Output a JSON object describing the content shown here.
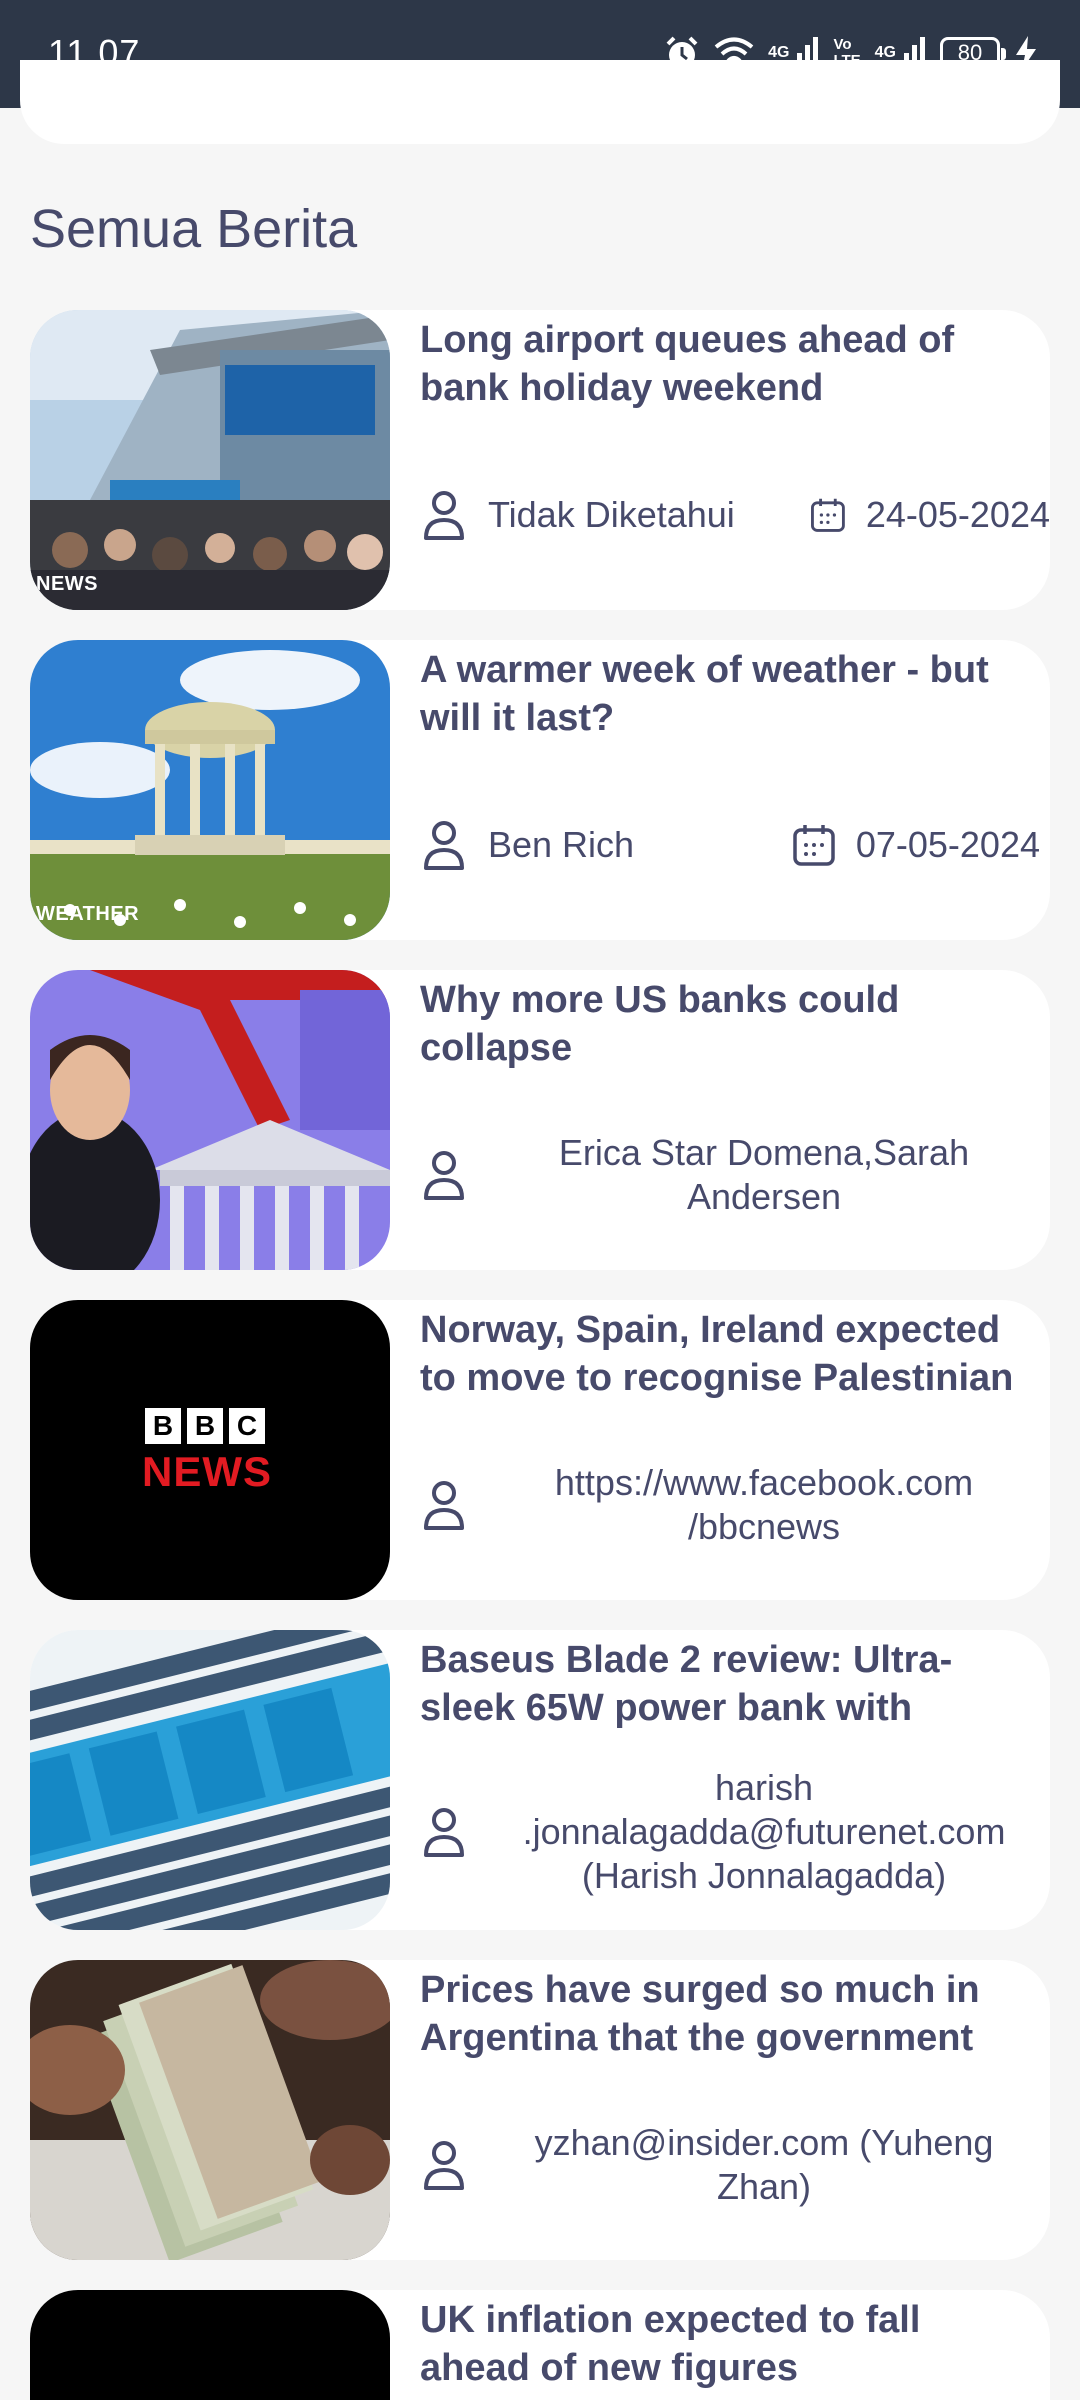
{
  "status_bar": {
    "time": "11.07",
    "network_1": "4G",
    "volte_line1": "Vo",
    "volte_line2": "LTE",
    "network_2": "4G",
    "battery": "80"
  },
  "section_title": "Semua Berita",
  "articles": [
    {
      "title": "Long airport queues ahead of bank holiday weekend",
      "author": "Tidak Diketahui",
      "date": "24-05-2024",
      "image_tag": "NEWS"
    },
    {
      "title": "A warmer week of weather - but will it last?",
      "author": "Ben Rich",
      "date": "07-05-2024",
      "image_tag": "WEATHER"
    },
    {
      "title": "Why more US banks could collapse",
      "author": "Erica Star Domena,Sarah Andersen"
    },
    {
      "title": "Norway, Spain, Ireland expected to move to recognise Palestinian",
      "author": "https://www.facebook.com /bbcnews",
      "image_text_1": "B",
      "image_text_2": "B",
      "image_text_3": "C",
      "image_text_4": "NEWS"
    },
    {
      "title": "Baseus Blade 2 review: Ultra-sleek 65W power bank with",
      "author": "harish .jonnalagadda@futurenet.com (Harish Jonnalagadda)"
    },
    {
      "title": "Prices have surged so much in Argentina that the government",
      "author": "yzhan@insider.com (Yuheng Zhan)"
    },
    {
      "title": "UK inflation expected to fall ahead of new figures"
    }
  ],
  "colors": {
    "status_bar_bg": "#2d3748",
    "page_bg": "#f6f6f6",
    "card_bg": "#ffffff",
    "text": "#474a6b"
  }
}
